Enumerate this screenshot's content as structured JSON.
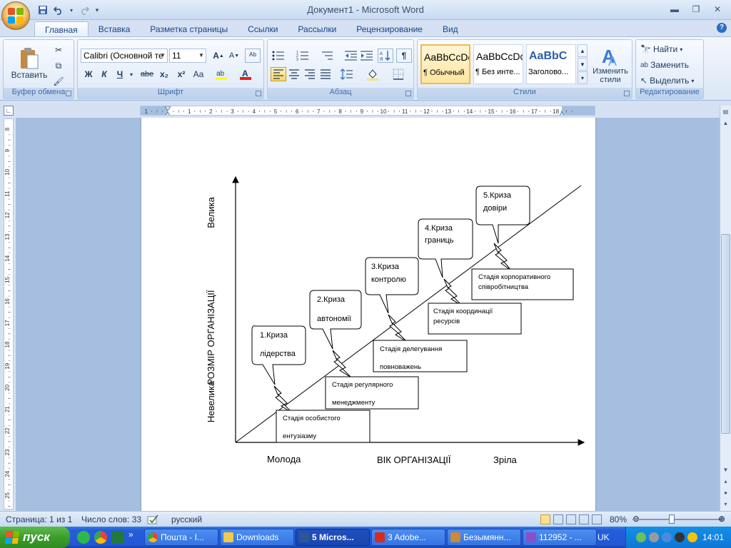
{
  "window": {
    "title": "Документ1 - Microsoft Word"
  },
  "tabs": [
    "Главная",
    "Вставка",
    "Разметка страницы",
    "Ссылки",
    "Рассылки",
    "Рецензирование",
    "Вид"
  ],
  "ribbon": {
    "clipboard": {
      "paste_label": "Вставить",
      "group_label": "Буфер обмена"
    },
    "font": {
      "font_name": "Calibri (Основной те",
      "font_size": "11",
      "group_label": "Шрифт",
      "bold": "Ж",
      "italic": "К",
      "underline": "Ч",
      "strike": "abe",
      "subscript": "x₂",
      "superscript": "x²",
      "case": "Aa"
    },
    "paragraph": {
      "group_label": "Абзац"
    },
    "styles": {
      "group_label": "Стили",
      "items": [
        {
          "preview": "AaBbCcDc",
          "name": "¶ Обычный"
        },
        {
          "preview": "AaBbCcDc",
          "name": "¶ Без инте..."
        },
        {
          "preview": "AaBbC",
          "name": "Заголово..."
        }
      ],
      "change_styles_label": "Изменить стили"
    },
    "editing": {
      "group_label": "Редактирование",
      "find": "Найти",
      "replace": "Заменить",
      "select": "Выделить"
    }
  },
  "diagram": {
    "y_axis_label": "РОЗМІР ОРГАНІЗАЦІЇ",
    "y_top_label": "Велика",
    "y_bottom_label": "Невелика",
    "x_axis_label": "ВІК ОРГАНІЗАЦІЇ",
    "x_left_label": "Молода",
    "x_right_label": "Зріла",
    "crises": [
      {
        "line1": "1.Криза",
        "line2": "лідерства"
      },
      {
        "line1": "2.Криза",
        "line2": "автономії"
      },
      {
        "line1": "3.Криза",
        "line2": "контролю"
      },
      {
        "line1": "4.Криза",
        "line2": "границь"
      },
      {
        "line1": "5.Криза",
        "line2": "довіри"
      }
    ],
    "stages": [
      {
        "line1": "Стадія особистого",
        "line2": "ентузіазму"
      },
      {
        "line1": "Стадія регулярного",
        "line2": "менеджменту"
      },
      {
        "line1": "Стадія делегування",
        "line2": "повноважень"
      },
      {
        "line1": "Стадія координації",
        "line2": "ресурсів"
      },
      {
        "line1": "Стадія корпоративного",
        "line2": "співробітництва"
      }
    ]
  },
  "status": {
    "page": "Страница: 1 из 1",
    "words": "Число слов: 33",
    "language": "русский",
    "zoom": "80%"
  },
  "taskbar": {
    "start": "пуск",
    "items": [
      {
        "label": "Пошта - I...",
        "color": "#e84c3d"
      },
      {
        "label": "Downloads",
        "color": "#f2c94c"
      },
      {
        "label": "5 Micros...",
        "color": "#2b5797"
      },
      {
        "label": "3 Adobe...",
        "color": "#d62b1f"
      },
      {
        "label": "Безымянн...",
        "color": "#c98a3b"
      },
      {
        "label": "112952 - ...",
        "color": "#8b4fc8"
      }
    ],
    "language": "UK",
    "clock": "14:01"
  }
}
